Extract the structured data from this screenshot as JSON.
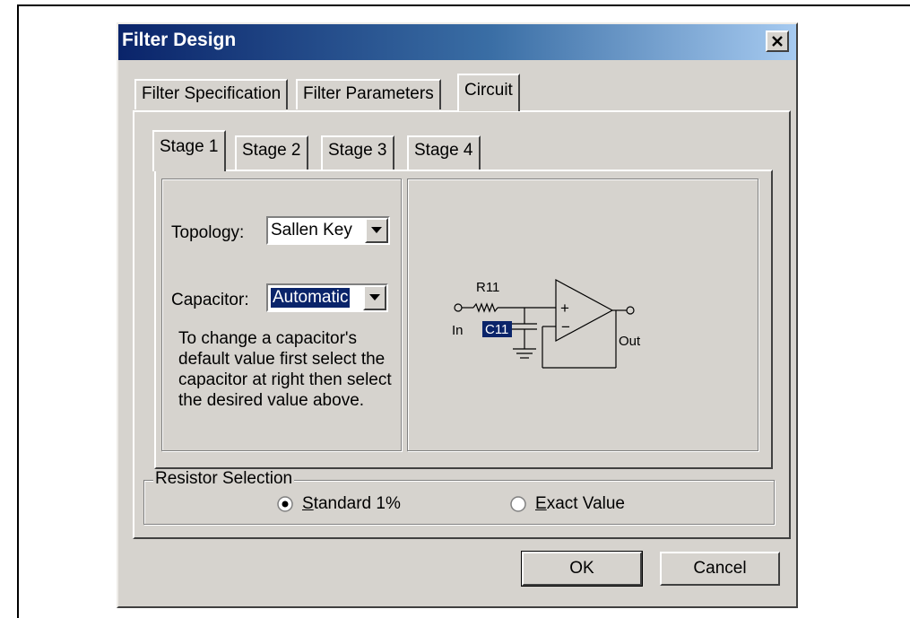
{
  "window": {
    "title": "Filter Design"
  },
  "tabs": [
    "Filter Specification",
    "Filter Parameters",
    "Circuit"
  ],
  "stage_tabs": [
    "Stage 1",
    "Stage 2",
    "Stage 3",
    "Stage 4"
  ],
  "topology": {
    "label": "Topology:",
    "value": "Sallen Key"
  },
  "capacitor": {
    "label": "Capacitor:",
    "value": "Automatic"
  },
  "note": "To change a capacitor's default value first select the capacitor at right then select the desired value above.",
  "schematic": {
    "resistor": "R11",
    "capacitor": "C11",
    "input": "In",
    "output": "Out",
    "plus": "+",
    "minus": "−"
  },
  "resistor_selection": {
    "legend": "Resistor Selection",
    "options": [
      {
        "prefix": "",
        "accel": "S",
        "rest": "tandard 1%",
        "checked": true
      },
      {
        "prefix": "",
        "accel": "E",
        "rest": "xact Value",
        "checked": false
      }
    ]
  },
  "buttons": {
    "ok": "OK",
    "cancel": "Cancel"
  },
  "colors": {
    "title_start": "#0a246a",
    "title_end": "#a6caf0",
    "face": "#d6d3ce",
    "selection": "#0a246a"
  }
}
